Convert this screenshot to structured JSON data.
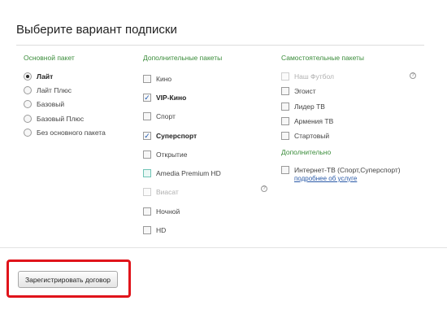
{
  "page": {
    "title": "Выберите вариант подписки"
  },
  "columns": {
    "main": {
      "header": "Основной пакет",
      "options": [
        {
          "label": "Лайт",
          "checked": true
        },
        {
          "label": "Лайт Плюс",
          "checked": false
        },
        {
          "label": "Базовый",
          "checked": false
        },
        {
          "label": "Базовый Плюс",
          "checked": false
        },
        {
          "label": "Без основного пакета",
          "checked": false
        }
      ]
    },
    "extra": {
      "header": "Дополнительные пакеты",
      "options": [
        {
          "label": "Кино",
          "checked": false
        },
        {
          "label": "VIP-Кино",
          "checked": true
        },
        {
          "label": "Спорт",
          "checked": false
        },
        {
          "label": "Суперспорт",
          "checked": true
        },
        {
          "label": "Открытие",
          "checked": false
        },
        {
          "label": "Amedia Premium HD",
          "checked": false
        },
        {
          "label": "Виасат",
          "checked": false,
          "disabled": true
        },
        {
          "label": "Ночной",
          "checked": false
        },
        {
          "label": "HD",
          "checked": false
        }
      ]
    },
    "standalone": {
      "header": "Самостоятельные пакеты",
      "options": [
        {
          "label": "Наш Футбол",
          "checked": false,
          "disabled": true
        },
        {
          "label": "Эгоист",
          "checked": false
        },
        {
          "label": "Лидер ТВ",
          "checked": false
        },
        {
          "label": "Армения ТВ",
          "checked": false
        },
        {
          "label": "Стартовый",
          "checked": false
        }
      ],
      "additional_header": "Дополнительно",
      "additional_option": {
        "label": "Интернет-ТВ (Спорт,Суперспорт)",
        "checked": false
      },
      "more_link": "подробнее об услуге"
    }
  },
  "help_icon": "?",
  "submit": {
    "label": "Зарегистрировать договор"
  },
  "colors": {
    "header_green": "#3a8c3a",
    "link_blue": "#2a5aa8",
    "highlight_red": "#e0141b"
  }
}
